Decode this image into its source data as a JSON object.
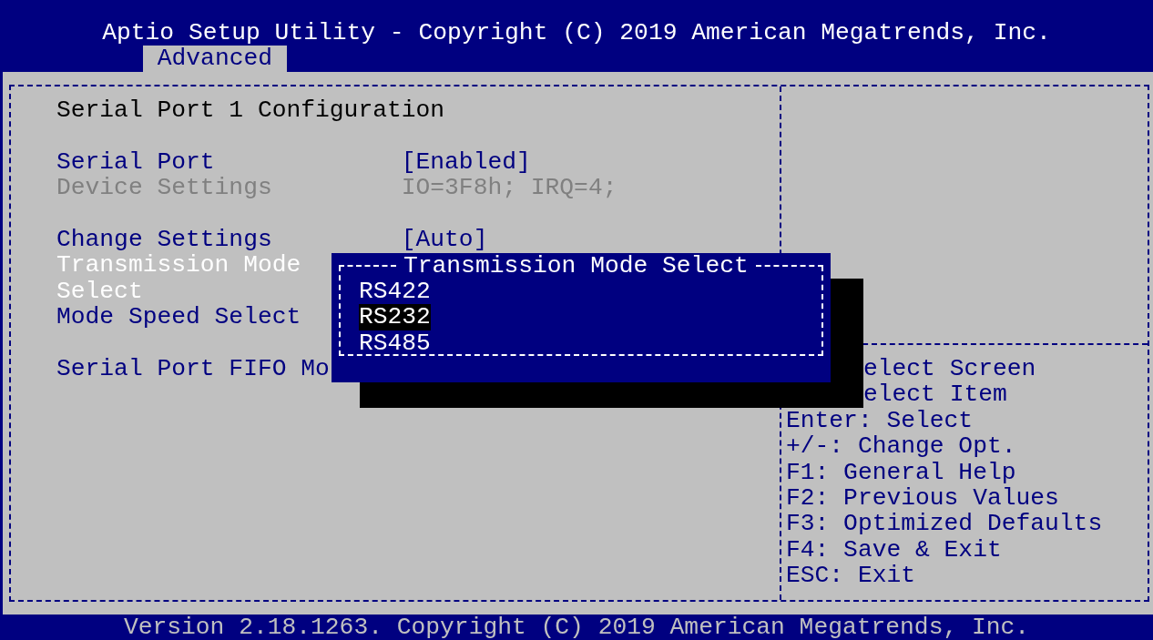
{
  "window": {
    "title": "Aptio Setup Utility - Copyright (C) 2019 American Megatrends, Inc."
  },
  "tabs": [
    {
      "label": "Advanced",
      "selected": true
    }
  ],
  "page": {
    "heading": "Serial Port 1 Configuration",
    "groups": [
      [
        {
          "label": "Serial Port",
          "value": "[Enabled]",
          "disabled": false,
          "selected": false
        },
        {
          "label": "Device Settings",
          "value": "IO=3F8h; IRQ=4;",
          "disabled": true,
          "selected": false
        }
      ],
      [
        {
          "label": "Change Settings",
          "value": "[Auto]",
          "disabled": false,
          "selected": false
        },
        {
          "label": "Transmission Mode Select",
          "disabled": false,
          "selected": true
        },
        {
          "label": "Mode Speed Select",
          "disabled": false,
          "selected": false
        }
      ],
      [
        {
          "label": "Serial Port FIFO Mo",
          "disabled": false,
          "selected": false
        }
      ]
    ]
  },
  "help": [
    {
      "text": "elect Screen",
      "covered": true
    },
    {
      "text": "elect Item",
      "covered": true
    },
    {
      "text": "Enter: Select",
      "covered": false
    },
    {
      "text": "+/-: Change Opt.",
      "covered": false
    },
    {
      "text": "F1: General Help",
      "covered": false
    },
    {
      "text": "F2: Previous Values",
      "covered": false
    },
    {
      "text": "F3: Optimized Defaults",
      "covered": false
    },
    {
      "text": "F4: Save & Exit",
      "covered": false
    },
    {
      "text": "ESC: Exit",
      "covered": false
    }
  ],
  "popup": {
    "title": "Transmission Mode Select",
    "options": [
      {
        "label": "RS422",
        "selected": false
      },
      {
        "label": "RS232",
        "selected": true
      },
      {
        "label": "RS485",
        "selected": false
      }
    ]
  },
  "status_bar": "Version 2.18.1263. Copyright (C) 2019 American Megatrends, Inc."
}
